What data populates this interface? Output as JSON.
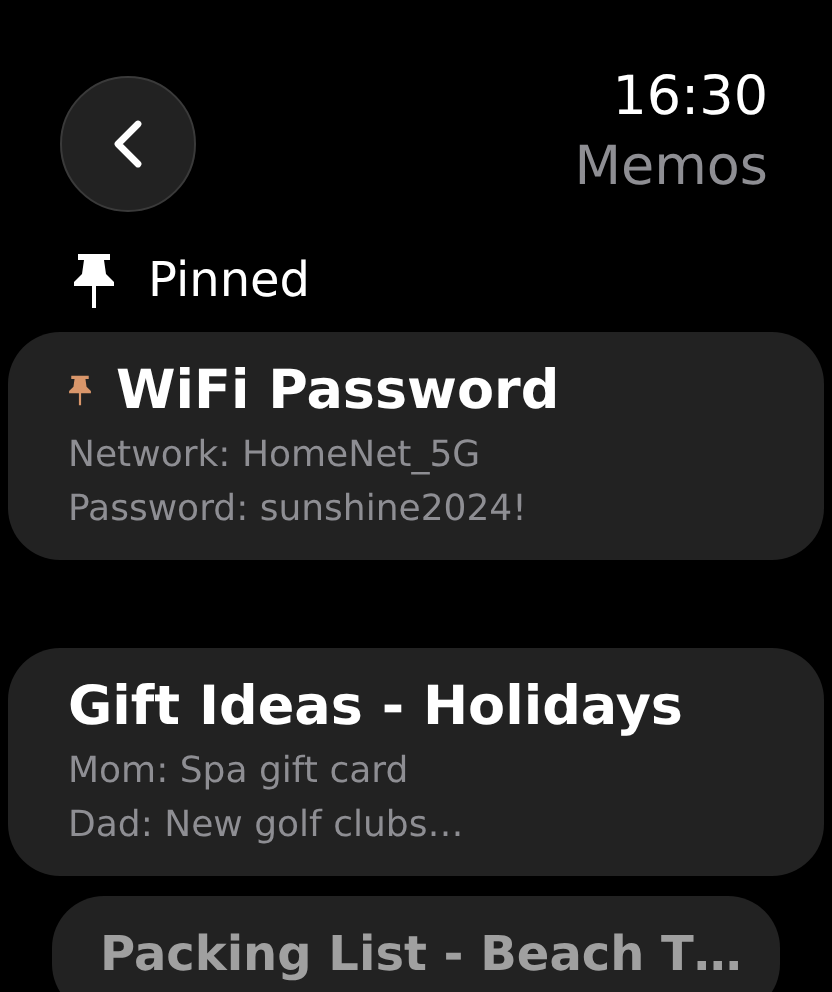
{
  "header": {
    "time": "16:30",
    "title": "Memos"
  },
  "section": {
    "label": "Pinned"
  },
  "memos": [
    {
      "title": "WiFi Password",
      "pinned": true,
      "dimmed": false,
      "lines": [
        "Network: HomeNet_5G",
        "Password: sunshine2024!"
      ]
    },
    {
      "title": "Gift Ideas - Holidays",
      "pinned": false,
      "dimmed": false,
      "lines": [
        "Mom: Spa gift card",
        "Dad: New golf clubs…"
      ]
    },
    {
      "title": "Packing List - Beach T…",
      "pinned": false,
      "dimmed": true
    }
  ]
}
